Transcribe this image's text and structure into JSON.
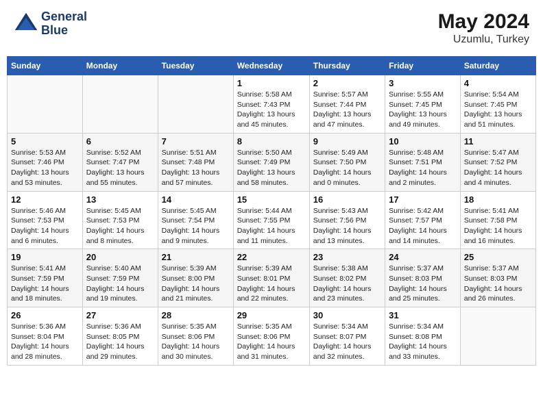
{
  "header": {
    "logo_line1": "General",
    "logo_line2": "Blue",
    "month_year": "May 2024",
    "location": "Uzumlu, Turkey"
  },
  "weekdays": [
    "Sunday",
    "Monday",
    "Tuesday",
    "Wednesday",
    "Thursday",
    "Friday",
    "Saturday"
  ],
  "weeks": [
    [
      {
        "day": "",
        "info": ""
      },
      {
        "day": "",
        "info": ""
      },
      {
        "day": "",
        "info": ""
      },
      {
        "day": "1",
        "info": "Sunrise: 5:58 AM\nSunset: 7:43 PM\nDaylight: 13 hours\nand 45 minutes."
      },
      {
        "day": "2",
        "info": "Sunrise: 5:57 AM\nSunset: 7:44 PM\nDaylight: 13 hours\nand 47 minutes."
      },
      {
        "day": "3",
        "info": "Sunrise: 5:55 AM\nSunset: 7:45 PM\nDaylight: 13 hours\nand 49 minutes."
      },
      {
        "day": "4",
        "info": "Sunrise: 5:54 AM\nSunset: 7:45 PM\nDaylight: 13 hours\nand 51 minutes."
      }
    ],
    [
      {
        "day": "5",
        "info": "Sunrise: 5:53 AM\nSunset: 7:46 PM\nDaylight: 13 hours\nand 53 minutes."
      },
      {
        "day": "6",
        "info": "Sunrise: 5:52 AM\nSunset: 7:47 PM\nDaylight: 13 hours\nand 55 minutes."
      },
      {
        "day": "7",
        "info": "Sunrise: 5:51 AM\nSunset: 7:48 PM\nDaylight: 13 hours\nand 57 minutes."
      },
      {
        "day": "8",
        "info": "Sunrise: 5:50 AM\nSunset: 7:49 PM\nDaylight: 13 hours\nand 58 minutes."
      },
      {
        "day": "9",
        "info": "Sunrise: 5:49 AM\nSunset: 7:50 PM\nDaylight: 14 hours\nand 0 minutes."
      },
      {
        "day": "10",
        "info": "Sunrise: 5:48 AM\nSunset: 7:51 PM\nDaylight: 14 hours\nand 2 minutes."
      },
      {
        "day": "11",
        "info": "Sunrise: 5:47 AM\nSunset: 7:52 PM\nDaylight: 14 hours\nand 4 minutes."
      }
    ],
    [
      {
        "day": "12",
        "info": "Sunrise: 5:46 AM\nSunset: 7:53 PM\nDaylight: 14 hours\nand 6 minutes."
      },
      {
        "day": "13",
        "info": "Sunrise: 5:45 AM\nSunset: 7:53 PM\nDaylight: 14 hours\nand 8 minutes."
      },
      {
        "day": "14",
        "info": "Sunrise: 5:45 AM\nSunset: 7:54 PM\nDaylight: 14 hours\nand 9 minutes."
      },
      {
        "day": "15",
        "info": "Sunrise: 5:44 AM\nSunset: 7:55 PM\nDaylight: 14 hours\nand 11 minutes."
      },
      {
        "day": "16",
        "info": "Sunrise: 5:43 AM\nSunset: 7:56 PM\nDaylight: 14 hours\nand 13 minutes."
      },
      {
        "day": "17",
        "info": "Sunrise: 5:42 AM\nSunset: 7:57 PM\nDaylight: 14 hours\nand 14 minutes."
      },
      {
        "day": "18",
        "info": "Sunrise: 5:41 AM\nSunset: 7:58 PM\nDaylight: 14 hours\nand 16 minutes."
      }
    ],
    [
      {
        "day": "19",
        "info": "Sunrise: 5:41 AM\nSunset: 7:59 PM\nDaylight: 14 hours\nand 18 minutes."
      },
      {
        "day": "20",
        "info": "Sunrise: 5:40 AM\nSunset: 7:59 PM\nDaylight: 14 hours\nand 19 minutes."
      },
      {
        "day": "21",
        "info": "Sunrise: 5:39 AM\nSunset: 8:00 PM\nDaylight: 14 hours\nand 21 minutes."
      },
      {
        "day": "22",
        "info": "Sunrise: 5:39 AM\nSunset: 8:01 PM\nDaylight: 14 hours\nand 22 minutes."
      },
      {
        "day": "23",
        "info": "Sunrise: 5:38 AM\nSunset: 8:02 PM\nDaylight: 14 hours\nand 23 minutes."
      },
      {
        "day": "24",
        "info": "Sunrise: 5:37 AM\nSunset: 8:03 PM\nDaylight: 14 hours\nand 25 minutes."
      },
      {
        "day": "25",
        "info": "Sunrise: 5:37 AM\nSunset: 8:03 PM\nDaylight: 14 hours\nand 26 minutes."
      }
    ],
    [
      {
        "day": "26",
        "info": "Sunrise: 5:36 AM\nSunset: 8:04 PM\nDaylight: 14 hours\nand 28 minutes."
      },
      {
        "day": "27",
        "info": "Sunrise: 5:36 AM\nSunset: 8:05 PM\nDaylight: 14 hours\nand 29 minutes."
      },
      {
        "day": "28",
        "info": "Sunrise: 5:35 AM\nSunset: 8:06 PM\nDaylight: 14 hours\nand 30 minutes."
      },
      {
        "day": "29",
        "info": "Sunrise: 5:35 AM\nSunset: 8:06 PM\nDaylight: 14 hours\nand 31 minutes."
      },
      {
        "day": "30",
        "info": "Sunrise: 5:34 AM\nSunset: 8:07 PM\nDaylight: 14 hours\nand 32 minutes."
      },
      {
        "day": "31",
        "info": "Sunrise: 5:34 AM\nSunset: 8:08 PM\nDaylight: 14 hours\nand 33 minutes."
      },
      {
        "day": "",
        "info": ""
      }
    ]
  ]
}
